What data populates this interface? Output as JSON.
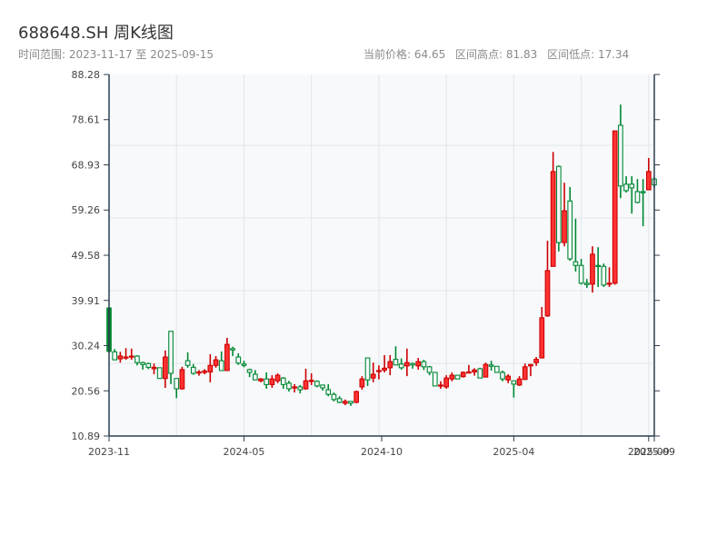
{
  "header": {
    "title": "688648.SH 周K线图",
    "range_label": "时间范围: 2023-11-17 至 2025-09-15",
    "current_price": "当前价格: 64.65",
    "range_high": "区间高点: 81.83",
    "range_low": "区间低点: 17.34"
  },
  "colors": {
    "up_fill": "#ff3333",
    "up_border": "#cc0000",
    "down_border": "#008833",
    "plot_background": "#f7f9fb",
    "axis": "#2d3e50",
    "grid": "#e2e6ea"
  },
  "chart_data": {
    "type": "candlestick",
    "title": "688648.SH 周K线图",
    "xlabel": "",
    "ylabel": "",
    "ylim": [
      10.89,
      88.28
    ],
    "grid": true,
    "y_ticks": [
      "10.89",
      "20.56",
      "30.24",
      "39.91",
      "49.58",
      "59.26",
      "68.93",
      "78.61",
      "88.28"
    ],
    "x_ticks": [
      {
        "label": "2023-11",
        "index": 0
      },
      {
        "label": "2024-05",
        "index": 24
      },
      {
        "label": "2024-10",
        "index": 48.5
      },
      {
        "label": "2025-04",
        "index": 72
      },
      {
        "label": "2025-09",
        "index": 96
      },
      {
        "label": "2025-09",
        "index": 97
      }
    ],
    "fields": [
      "open",
      "high",
      "low",
      "close"
    ],
    "ohlc": [
      [
        38.3,
        38.3,
        28.8,
        29.0
      ],
      [
        28.9,
        29.5,
        27.2,
        27.2
      ],
      [
        27.4,
        28.9,
        26.6,
        28.0
      ],
      [
        27.6,
        29.7,
        27.2,
        27.8
      ],
      [
        27.8,
        29.6,
        27.2,
        28.0
      ],
      [
        28.0,
        28.2,
        26.0,
        26.6
      ],
      [
        26.6,
        26.8,
        25.1,
        26.2
      ],
      [
        26.4,
        26.6,
        25.2,
        25.6
      ],
      [
        25.3,
        26.4,
        24.1,
        25.6
      ],
      [
        25.5,
        25.5,
        23.2,
        23.2
      ],
      [
        23.2,
        29.2,
        21.2,
        27.8
      ],
      [
        33.3,
        33.3,
        22.0,
        24.3
      ],
      [
        23.2,
        23.2,
        19.0,
        21.0
      ],
      [
        21.0,
        25.7,
        20.8,
        25.1
      ],
      [
        27.0,
        28.8,
        25.5,
        26.0
      ],
      [
        25.6,
        26.3,
        24.0,
        24.3
      ],
      [
        24.4,
        25.0,
        23.8,
        24.6
      ],
      [
        24.5,
        25.2,
        24.1,
        24.8
      ],
      [
        24.6,
        28.4,
        22.4,
        26.0
      ],
      [
        26.0,
        28.0,
        25.5,
        27.2
      ],
      [
        27.0,
        29.0,
        24.9,
        24.9
      ],
      [
        24.9,
        31.9,
        24.9,
        30.5
      ],
      [
        29.6,
        30.0,
        28.0,
        29.3
      ],
      [
        27.8,
        28.6,
        26.1,
        26.5
      ],
      [
        26.3,
        27.0,
        25.6,
        26.0
      ],
      [
        25.1,
        25.3,
        23.5,
        24.5
      ],
      [
        24.1,
        25.0,
        22.9,
        22.9
      ],
      [
        22.7,
        23.3,
        22.4,
        23.1
      ],
      [
        23.1,
        24.5,
        21.0,
        21.9
      ],
      [
        21.9,
        23.9,
        21.2,
        23.1
      ],
      [
        22.7,
        24.3,
        22.2,
        23.9
      ],
      [
        23.3,
        23.5,
        21.0,
        21.9
      ],
      [
        22.2,
        22.7,
        20.4,
        21.0
      ],
      [
        21.2,
        22.0,
        20.2,
        21.4
      ],
      [
        21.4,
        21.8,
        20.0,
        20.8
      ],
      [
        21.0,
        25.3,
        20.8,
        22.7
      ],
      [
        22.6,
        24.3,
        21.8,
        22.8
      ],
      [
        22.6,
        22.8,
        21.3,
        21.6
      ],
      [
        21.8,
        21.8,
        20.6,
        21.2
      ],
      [
        20.8,
        22.0,
        19.4,
        19.8
      ],
      [
        19.8,
        20.2,
        18.3,
        18.7
      ],
      [
        18.9,
        19.4,
        17.9,
        18.1
      ],
      [
        17.9,
        18.7,
        17.5,
        18.3
      ],
      [
        18.3,
        18.3,
        17.34,
        17.9
      ],
      [
        18.1,
        20.6,
        17.9,
        20.4
      ],
      [
        21.4,
        23.7,
        20.8,
        23.1
      ],
      [
        27.6,
        27.6,
        21.6,
        22.9
      ],
      [
        23.3,
        26.6,
        22.4,
        24.1
      ],
      [
        24.7,
        26.0,
        23.0,
        24.9
      ],
      [
        25.0,
        28.2,
        24.5,
        25.4
      ],
      [
        25.5,
        28.2,
        23.9,
        26.8
      ],
      [
        27.3,
        30.1,
        26.1,
        26.1
      ],
      [
        26.3,
        27.5,
        25.1,
        25.5
      ],
      [
        25.9,
        29.6,
        23.7,
        26.6
      ],
      [
        26.4,
        26.6,
        25.3,
        26.1
      ],
      [
        25.9,
        27.6,
        25.1,
        26.8
      ],
      [
        26.8,
        27.2,
        25.0,
        25.7
      ],
      [
        25.7,
        25.9,
        23.9,
        24.5
      ],
      [
        24.5,
        24.5,
        21.6,
        21.6
      ],
      [
        21.6,
        22.6,
        21.0,
        21.8
      ],
      [
        21.4,
        23.9,
        21.0,
        23.3
      ],
      [
        23.1,
        24.5,
        22.6,
        23.9
      ],
      [
        23.9,
        23.9,
        23.1,
        23.1
      ],
      [
        23.6,
        24.7,
        23.4,
        24.5
      ],
      [
        24.4,
        26.1,
        24.4,
        24.6
      ],
      [
        24.6,
        25.4,
        23.8,
        25.0
      ],
      [
        25.3,
        25.5,
        23.3,
        23.3
      ],
      [
        23.5,
        26.6,
        23.5,
        26.2
      ],
      [
        26.1,
        27.0,
        24.9,
        25.8
      ],
      [
        25.8,
        25.8,
        24.5,
        24.5
      ],
      [
        24.5,
        24.9,
        22.6,
        23.1
      ],
      [
        22.9,
        24.1,
        22.2,
        23.7
      ],
      [
        22.7,
        22.7,
        19.1,
        22.0
      ],
      [
        21.8,
        23.7,
        21.6,
        23.1
      ],
      [
        23.0,
        26.4,
        22.9,
        25.7
      ],
      [
        25.9,
        26.3,
        23.7,
        26.2
      ],
      [
        26.6,
        27.8,
        25.9,
        27.3
      ],
      [
        27.6,
        38.5,
        27.6,
        36.2
      ],
      [
        36.6,
        52.7,
        36.4,
        46.3
      ],
      [
        47.2,
        71.7,
        47.2,
        67.5
      ],
      [
        68.6,
        68.8,
        50.4,
        52.3
      ],
      [
        52.3,
        65.1,
        51.5,
        59.1
      ],
      [
        61.2,
        64.2,
        48.4,
        48.8
      ],
      [
        48.2,
        57.4,
        46.1,
        47.4
      ],
      [
        47.4,
        48.8,
        43.3,
        43.6
      ],
      [
        43.6,
        44.5,
        42.6,
        43.3
      ],
      [
        43.4,
        51.5,
        41.6,
        49.8
      ],
      [
        47.4,
        51.3,
        42.8,
        47.2
      ],
      [
        47.2,
        47.8,
        42.8,
        43.2
      ],
      [
        43.4,
        47.0,
        42.8,
        43.6
      ],
      [
        43.6,
        76.2,
        43.3,
        76.2
      ],
      [
        77.4,
        81.83,
        61.8,
        64.4
      ],
      [
        64.8,
        66.5,
        63.0,
        63.4
      ],
      [
        64.8,
        66.5,
        58.5,
        64.0
      ],
      [
        63.2,
        65.9,
        60.7,
        60.9
      ],
      [
        63.2,
        65.9,
        55.8,
        63.0
      ],
      [
        63.6,
        70.4,
        63.6,
        67.5
      ],
      [
        65.9,
        66.3,
        64.0,
        64.65
      ]
    ]
  }
}
